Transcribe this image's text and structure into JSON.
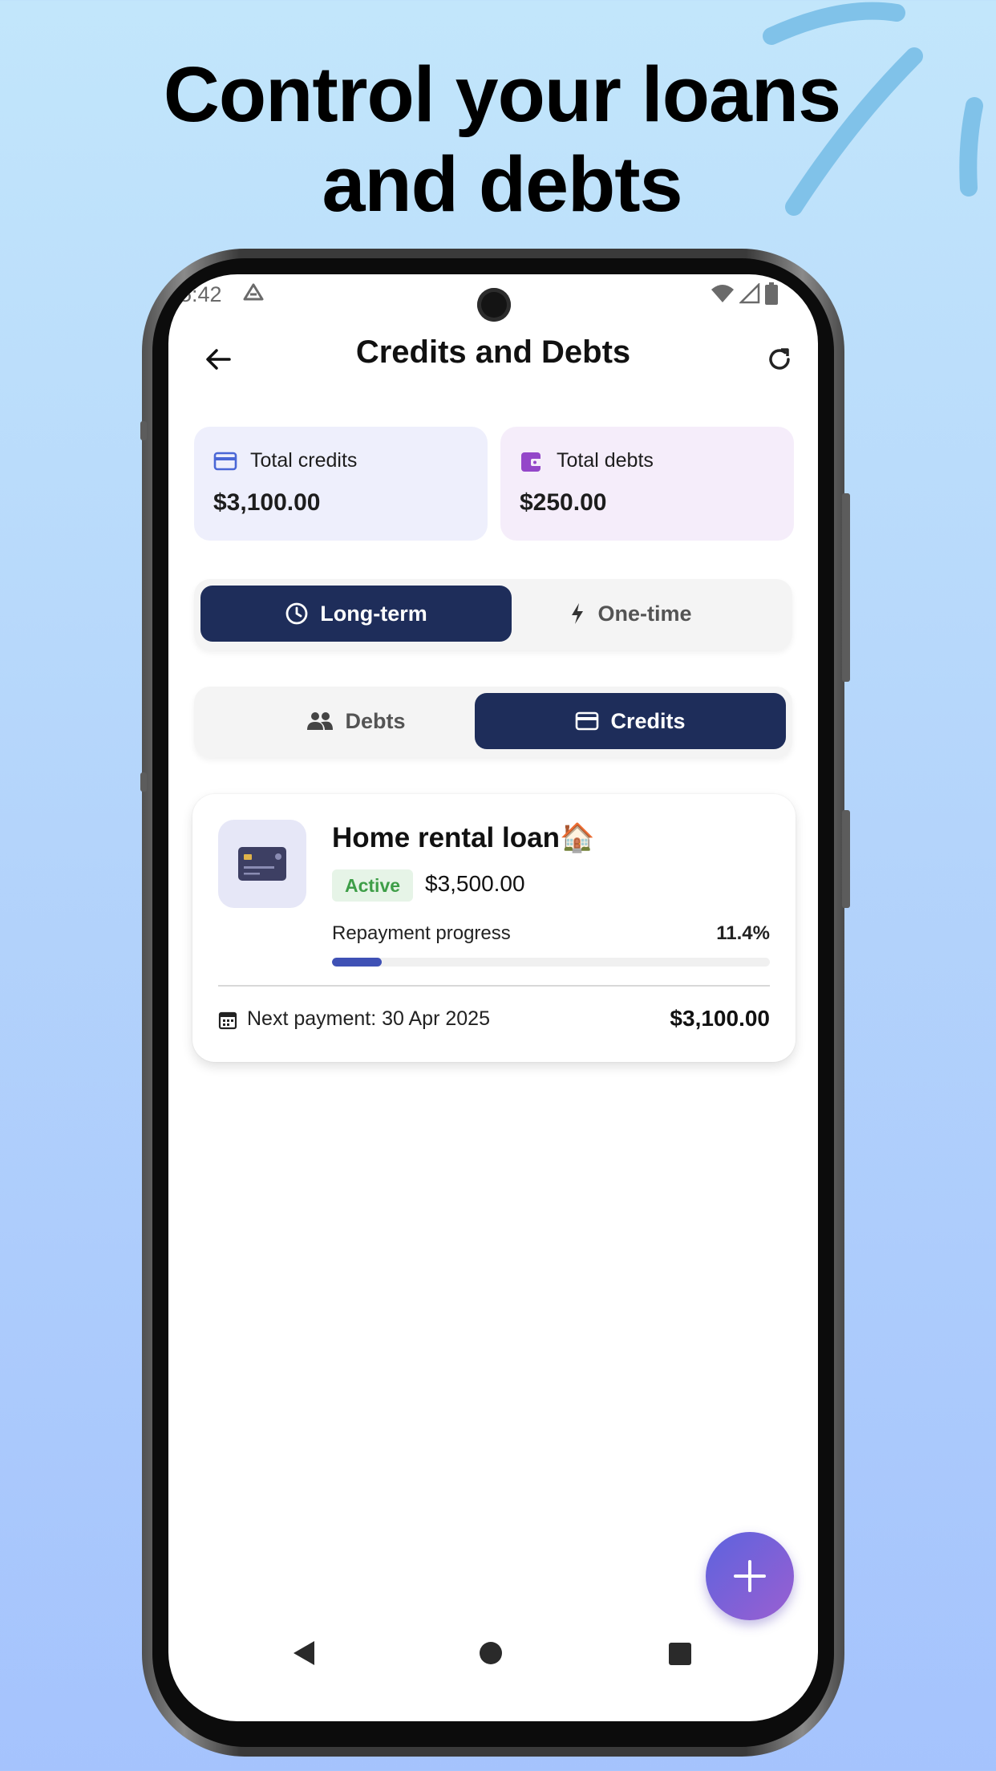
{
  "headline": {
    "line1": "Control your loans",
    "line2": "and debts"
  },
  "status_bar": {
    "time": "5:42"
  },
  "appbar": {
    "title": "Credits and Debts"
  },
  "summary": {
    "credits": {
      "label": "Total credits",
      "value": "$3,100.00",
      "icon": "credit-card-icon"
    },
    "debts": {
      "label": "Total debts",
      "value": "$250.00",
      "icon": "wallet-icon"
    }
  },
  "term_toggle": {
    "long_term": "Long-term",
    "one_time": "One-time",
    "selected": "Long-term"
  },
  "type_toggle": {
    "debts": "Debts",
    "credits": "Credits",
    "selected": "Credits"
  },
  "loan": {
    "title": "Home rental loan🏠",
    "status": "Active",
    "amount": "$3,500.00",
    "progress_label": "Repayment progress",
    "progress_text": "11.4%",
    "progress_value": 0.114,
    "next_payment": "Next payment: 30 Apr 2025",
    "next_amount": "$3,100.00"
  },
  "colors": {
    "primary_dark": "#1e2d5a",
    "progress": "#3f51b5",
    "active_badge": "#3e9e48",
    "fab_start": "#5d63de",
    "fab_end": "#9a5fd1"
  }
}
